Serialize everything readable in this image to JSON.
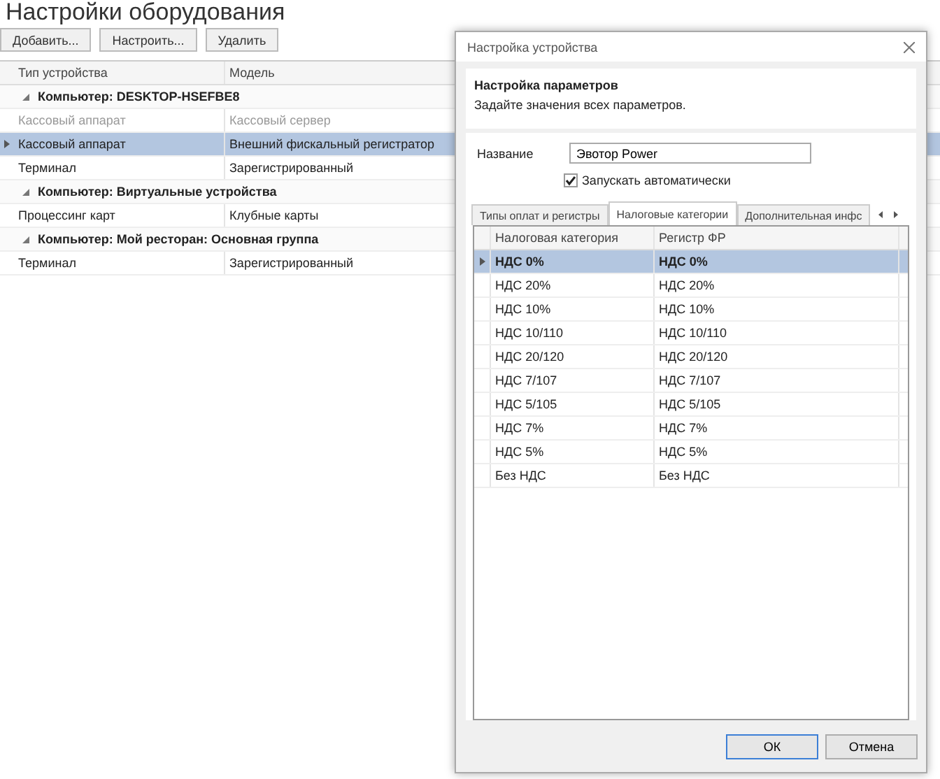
{
  "page": {
    "title": "Настройки оборудования",
    "buttons": [
      "Добавить...",
      "Настроить...",
      "Удалить"
    ],
    "table": {
      "columns": [
        "Тип устройства",
        "Модель"
      ],
      "groups": [
        {
          "label": "Компьютер: DESKTOP-HSEFBE8",
          "expanded": true,
          "children": [
            {
              "cells": [
                "Кассовый аппарат",
                "Кассовый сервер"
              ],
              "disabled": true,
              "selected": false
            },
            {
              "cells": [
                "Кассовый аппарат",
                "Внешний фискальный регистратор"
              ],
              "disabled": false,
              "selected": true
            },
            {
              "cells": [
                "Терминал",
                "Зарегистрированный"
              ],
              "disabled": false,
              "selected": false
            }
          ]
        },
        {
          "label": "Компьютер: Виртуальные устройства",
          "expanded": true,
          "children": [
            {
              "cells": [
                "Процессинг карт",
                "Клубные карты"
              ],
              "disabled": false,
              "selected": false
            }
          ]
        },
        {
          "label": "Компьютер: Мой ресторан: Основная группа",
          "expanded": true,
          "children": [
            {
              "cells": [
                "Терминал",
                "Зарегистрированный"
              ],
              "disabled": false,
              "selected": false
            }
          ]
        }
      ]
    }
  },
  "dialog": {
    "title": "Настройка устройства",
    "header_title": "Настройка параметров",
    "header_subtitle": "Задайте значения всех параметров.",
    "name_label": "Название",
    "name_value": "Эвотор Power",
    "autostart": {
      "label": "Запускать автоматически",
      "checked": true
    },
    "tabs": [
      {
        "label": "Типы оплат и регистры",
        "selected": false
      },
      {
        "label": "Налоговые категории",
        "selected": true
      },
      {
        "label": "Дополнительная инфс",
        "selected": false
      }
    ],
    "grid": {
      "columns": [
        "Налоговая категория",
        "Регистр ФР"
      ],
      "rows": [
        {
          "cells": [
            "НДС 0%",
            "НДС 0%"
          ],
          "selected": true
        },
        {
          "cells": [
            "НДС 20%",
            "НДС 20%"
          ],
          "selected": false
        },
        {
          "cells": [
            "НДС 10%",
            "НДС 10%"
          ],
          "selected": false
        },
        {
          "cells": [
            "НДС 10/110",
            "НДС 10/110"
          ],
          "selected": false
        },
        {
          "cells": [
            "НДС 20/120",
            "НДС 20/120"
          ],
          "selected": false
        },
        {
          "cells": [
            "НДС 7/107",
            "НДС 7/107"
          ],
          "selected": false
        },
        {
          "cells": [
            "НДС 5/105",
            "НДС 5/105"
          ],
          "selected": false
        },
        {
          "cells": [
            "НДС 7%",
            "НДС 7%"
          ],
          "selected": false
        },
        {
          "cells": [
            "НДС 5%",
            "НДС 5%"
          ],
          "selected": false
        },
        {
          "cells": [
            "Без НДС",
            "Без НДС"
          ],
          "selected": false
        }
      ]
    },
    "buttons": [
      "ОК",
      "Отмена"
    ]
  }
}
